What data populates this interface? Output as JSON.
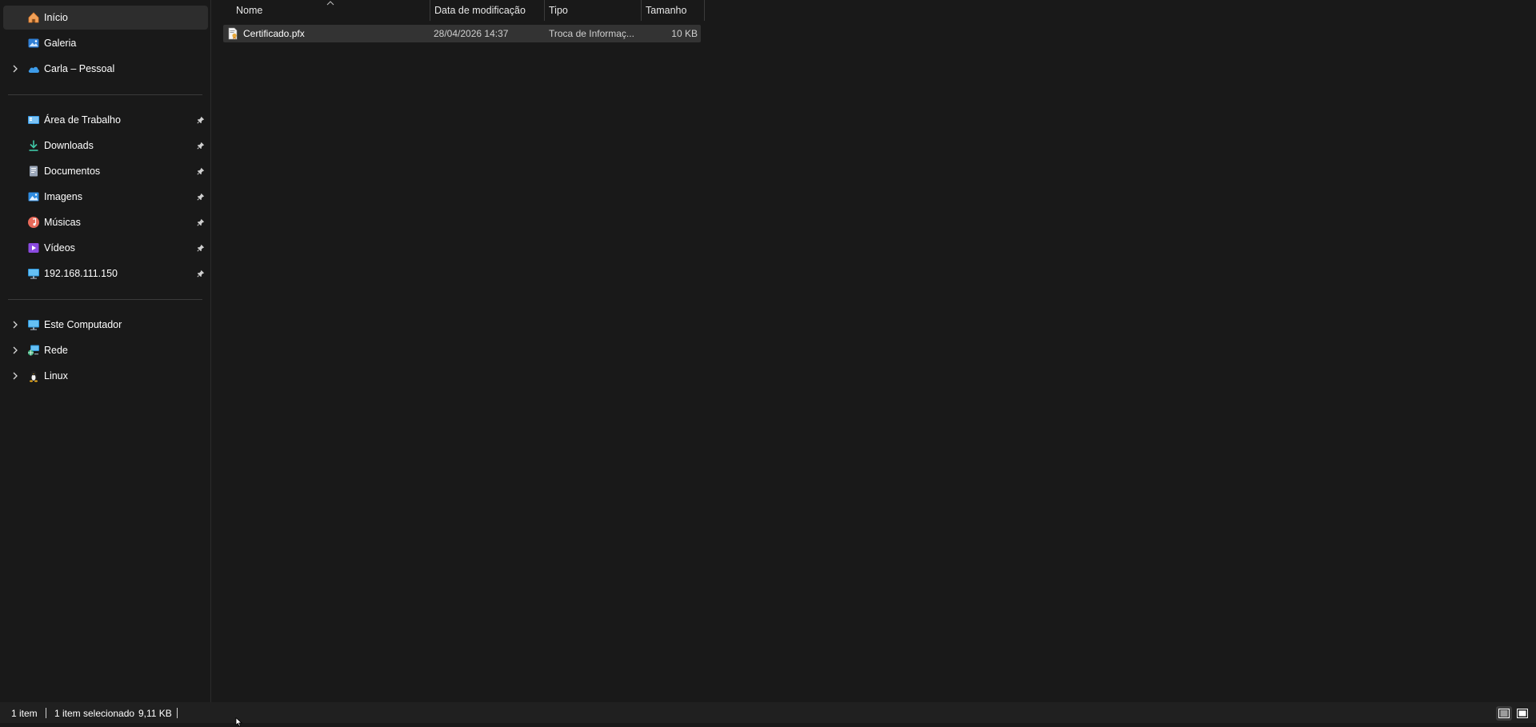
{
  "sidebar": {
    "quick": [
      {
        "label": "Início",
        "icon": "home-icon",
        "selected": true
      },
      {
        "label": "Galeria",
        "icon": "gallery-icon"
      },
      {
        "label": "Carla – Pessoal",
        "icon": "onedrive-cloud-icon",
        "expandable": true
      }
    ],
    "pinned": [
      {
        "label": "Área de Trabalho",
        "icon": "desktop-icon"
      },
      {
        "label": "Downloads",
        "icon": "download-icon"
      },
      {
        "label": "Documentos",
        "icon": "documents-icon"
      },
      {
        "label": "Imagens",
        "icon": "pictures-icon"
      },
      {
        "label": "Músicas",
        "icon": "music-icon"
      },
      {
        "label": "Vídeos",
        "icon": "videos-icon"
      },
      {
        "label": "192.168.111.150",
        "icon": "network-drive-icon"
      }
    ],
    "devices": [
      {
        "label": "Este Computador",
        "icon": "computer-icon"
      },
      {
        "label": "Rede",
        "icon": "network-icon"
      },
      {
        "label": "Linux",
        "icon": "linux-icon"
      }
    ]
  },
  "columns": {
    "name": "Nome",
    "date": "Data de modificação",
    "type": "Tipo",
    "size": "Tamanho"
  },
  "files": [
    {
      "name": "Certificado.pfx",
      "date": "28/04/2026 14:37",
      "type": "Troca de Informaç...",
      "size": "10 KB",
      "icon": "certificate-file-icon"
    }
  ],
  "status": {
    "count": "1 item",
    "selected": "1 item selecionado",
    "selected_size": "9,11 KB"
  },
  "colors": {
    "background": "#191919",
    "selected_row": "#333333",
    "statusbar": "#202020"
  }
}
